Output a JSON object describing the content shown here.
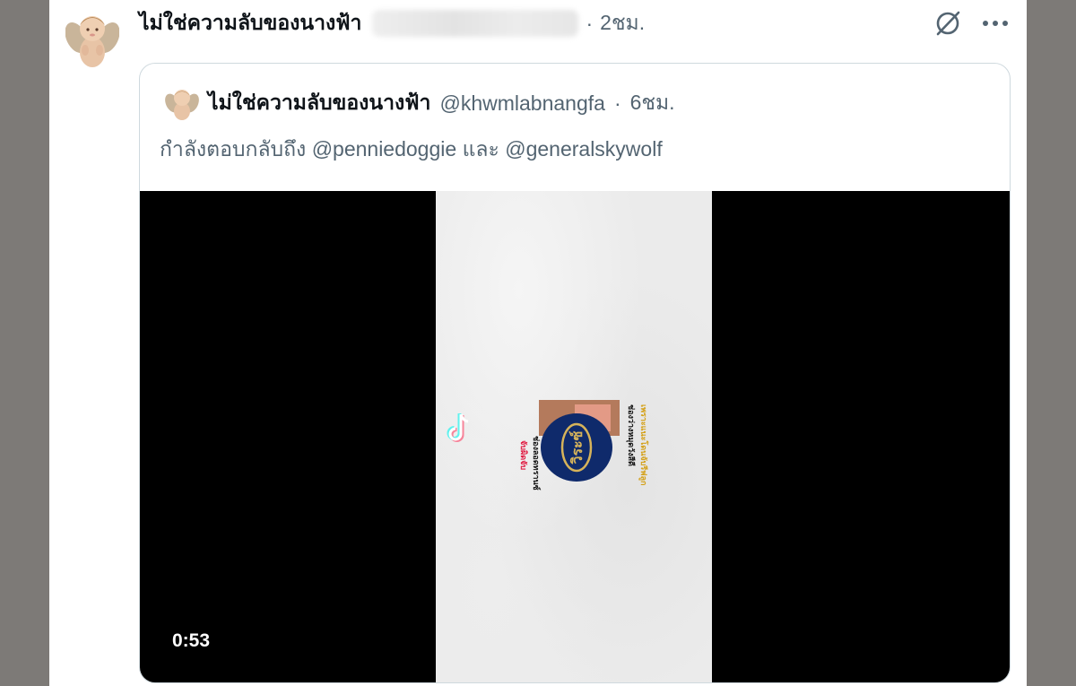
{
  "post": {
    "display_name": "ไม่ใช่ความลับของนางฟ้า",
    "separator": "·",
    "timestamp": "2ชม.",
    "actions": {
      "grok_icon": "grok-icon",
      "more_icon": "more-icon"
    }
  },
  "quote": {
    "display_name": "ไม่ใช่ความลับของนางฟ้า",
    "handle": "@khwmlabnangfa",
    "separator": "·",
    "timestamp": "6ชม.",
    "reply_prefix": "กำลังตอบกลับถึง",
    "reply_mention_1": "@penniedoggie",
    "reply_joiner": "และ",
    "reply_mention_2": "@generalskywolf"
  },
  "video": {
    "duration": "0:53",
    "overlay_logo_text": "วิระซ์",
    "overlay_caption": "จับผิดจับหน่อย ข้างลอดทรานซ์ ช่องว่างหมุดวังสีดี เพราะแนะโดนจับรีฟลูก",
    "watermark_icon": "tiktok-logo-icon"
  },
  "colors": {
    "backdrop": "#7d7a77",
    "text_primary": "#0f1419",
    "text_secondary": "#536471",
    "border": "#cfd9de"
  }
}
